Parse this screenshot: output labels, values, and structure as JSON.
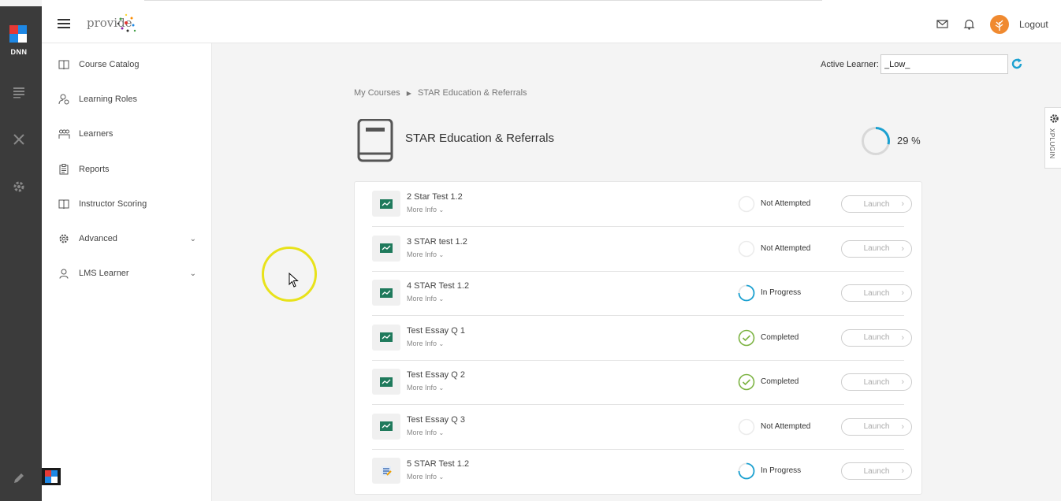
{
  "brand": {
    "name": "provide"
  },
  "dnn": {
    "label": "DNN"
  },
  "header": {
    "logout": "Logout"
  },
  "sidebar": {
    "items": [
      {
        "label": "Course Catalog",
        "icon": "book-open-icon"
      },
      {
        "label": "Learning Roles",
        "icon": "roles-icon"
      },
      {
        "label": "Learners",
        "icon": "learners-icon"
      },
      {
        "label": "Reports",
        "icon": "clipboard-icon"
      },
      {
        "label": "Instructor Scoring",
        "icon": "book-open-icon"
      },
      {
        "label": "Advanced",
        "icon": "gear-icon"
      },
      {
        "label": "LMS Learner",
        "icon": "person-icon"
      }
    ]
  },
  "learner": {
    "label": "Active Learner:",
    "value": "_Low_"
  },
  "breadcrumb": {
    "root": "My Courses",
    "current": "STAR Education & Referrals"
  },
  "course": {
    "title": "STAR Education & Referrals",
    "progress_percent": 29,
    "progress_label": "29 %"
  },
  "xplugin": {
    "label": "XPLUGIN"
  },
  "modules": [
    {
      "title": "2 Star Test 1.2",
      "more": "More Info",
      "status": "Not Attempted",
      "state": "not",
      "launch": "Launch",
      "kind": "presentation"
    },
    {
      "title": "3 STAR test 1.2",
      "more": "More Info",
      "status": "Not Attempted",
      "state": "not",
      "launch": "Launch",
      "kind": "presentation"
    },
    {
      "title": "4 STAR Test 1.2",
      "more": "More Info",
      "status": "In Progress",
      "state": "progress",
      "launch": "Launch",
      "kind": "presentation"
    },
    {
      "title": "Test Essay Q 1",
      "more": "More Info",
      "status": "Completed",
      "state": "done",
      "launch": "Launch",
      "kind": "presentation"
    },
    {
      "title": "Test Essay Q 2",
      "more": "More Info",
      "status": "Completed",
      "state": "done",
      "launch": "Launch",
      "kind": "presentation"
    },
    {
      "title": "Test Essay Q 3",
      "more": "More Info",
      "status": "Not Attempted",
      "state": "not",
      "launch": "Launch",
      "kind": "presentation"
    },
    {
      "title": "5 STAR Test 1.2",
      "more": "More Info",
      "status": "In Progress",
      "state": "progress",
      "launch": "Launch",
      "kind": "document"
    }
  ],
  "colors": {
    "accent": "#1ba1d1",
    "complete": "#7cb342",
    "avatar": "#f08a30"
  }
}
